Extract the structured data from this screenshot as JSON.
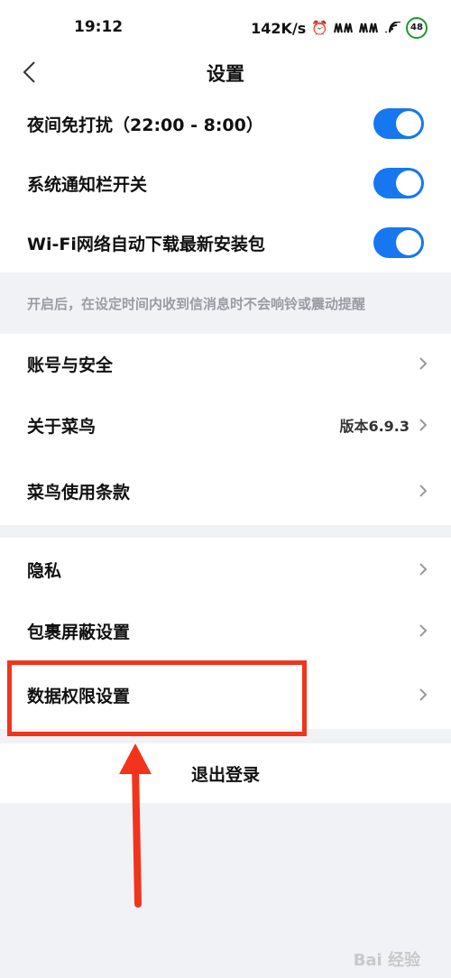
{
  "status_bar": {
    "time": "19:12",
    "speed": "142K/s",
    "battery": "48"
  },
  "nav": {
    "title": "设置"
  },
  "toggles": [
    {
      "label": "夜间免打扰（22:00 - 8:00）",
      "on": true
    },
    {
      "label": "系统通知栏开关",
      "on": true
    },
    {
      "label": "Wi-Fi网络自动下载最新安装包",
      "on": true
    }
  ],
  "notice": "开启后，在设定时间内收到信消息时不会响铃或震动提醒",
  "group2": [
    {
      "label": "账号与安全"
    },
    {
      "label": "关于菜鸟",
      "value": "版本6.9.3"
    },
    {
      "label": "菜鸟使用条款"
    }
  ],
  "group3": [
    {
      "label": "隐私"
    },
    {
      "label": "包裹屏蔽设置"
    },
    {
      "label": "数据权限设置"
    }
  ],
  "logout_label": "退出登录",
  "annotation": {
    "color": "#f2341c"
  },
  "watermark": "Bai 经验",
  "colors": {
    "toggle_on": "#1677f0",
    "background": "#f1f2f6"
  }
}
